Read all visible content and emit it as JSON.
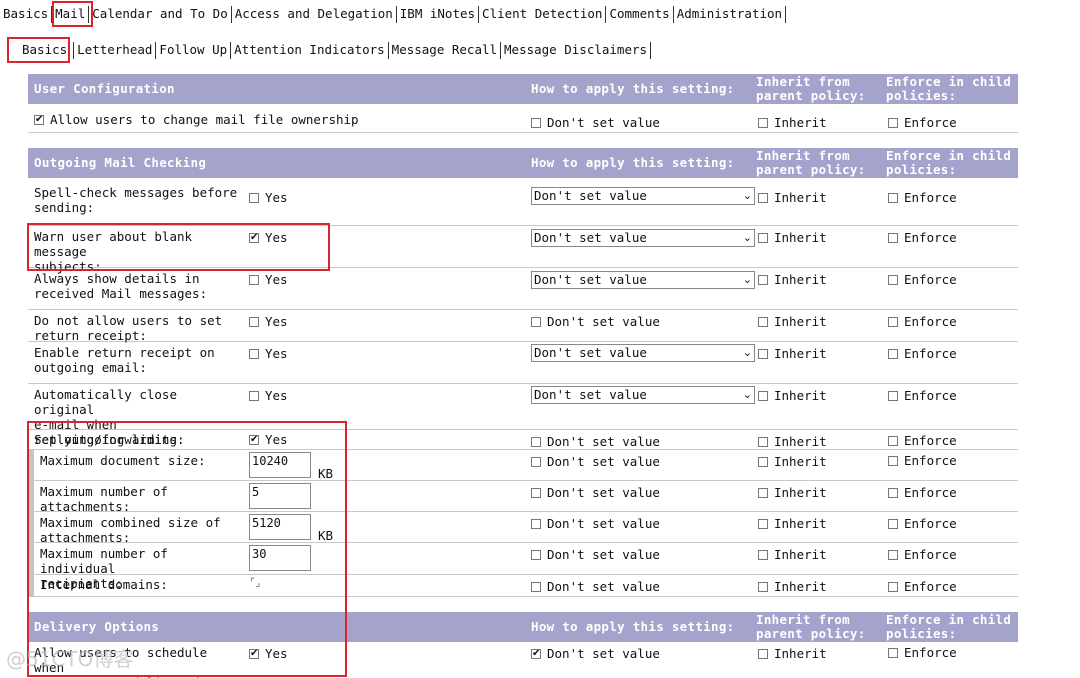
{
  "top_tabs": [
    "Basics",
    "Mail",
    "Calendar and To Do",
    "Access and Delegation",
    "IBM iNotes",
    "Client Detection",
    "Comments",
    "Administration"
  ],
  "sub_tabs": [
    "Basics",
    "Letterhead",
    "Follow Up",
    "Attention Indicators",
    "Message Recall",
    "Message Disclaimers"
  ],
  "columns": {
    "how": "How to apply this setting:",
    "inherit": "Inherit from parent policy:",
    "enforce": "Enforce in child policies:"
  },
  "options": {
    "yes": "Yes",
    "dont_set": "Don't set value",
    "inherit": "Inherit",
    "enforce": "Enforce"
  },
  "sections": {
    "user_config": {
      "title": "User Configuration",
      "allow_ownership": "Allow users to change mail file ownership"
    },
    "outgoing": {
      "title": "Outgoing Mail Checking",
      "rows": [
        "Spell-check messages before\nsending:",
        "Warn user about blank message\nsubjects:",
        "Always show details in\nreceived Mail messages:",
        "Do not allow users to set\nreturn receipt:",
        "Enable return receipt on\noutgoing email:",
        "Automatically close original\ne-mail when\nreplying/forwarding:",
        "Set outgoing limits:"
      ],
      "limits": [
        {
          "label": "Maximum document size:",
          "value": "10240",
          "unit": "KB"
        },
        {
          "label": "Maximum number of\nattachments:",
          "value": "5",
          "unit": ""
        },
        {
          "label": "Maximum combined size of\nattachments:",
          "value": "5120",
          "unit": "KB"
        },
        {
          "label": "Maximum number of individual\nrecipients:",
          "value": "30",
          "unit": ""
        },
        {
          "label": "Internal domains:",
          "value": "",
          "unit": ""
        }
      ]
    },
    "delivery": {
      "title": "Delivery Options",
      "schedule": "Allow users to schedule when\nmessages are delivered:"
    }
  },
  "watermark": "@51CTO博客",
  "colors": {
    "header_bg": "#a3a3cc",
    "highlight_box": "#d9262c"
  }
}
